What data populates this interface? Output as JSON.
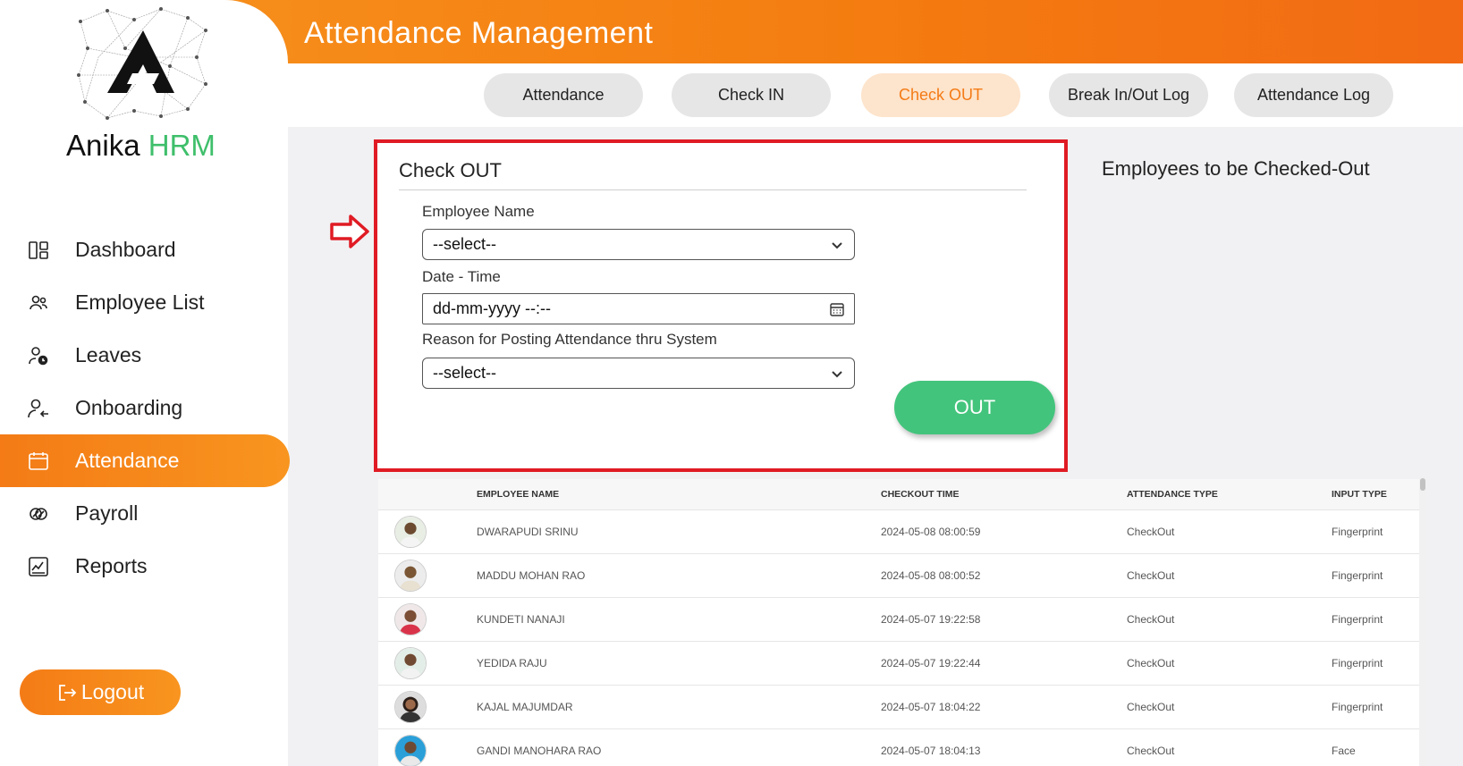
{
  "app": {
    "title": "Attendance Management"
  },
  "brand": {
    "name_part1": "Anika",
    "name_part2": "HRM"
  },
  "sidebar": {
    "items": [
      {
        "label": "Dashboard",
        "icon": "dashboard-icon",
        "active": false
      },
      {
        "label": "Employee List",
        "icon": "users-icon",
        "active": false
      },
      {
        "label": "Leaves",
        "icon": "user-clock-icon",
        "active": false
      },
      {
        "label": "Onboarding",
        "icon": "user-arrow-icon",
        "active": false
      },
      {
        "label": "Attendance",
        "icon": "calendar-icon",
        "active": true
      },
      {
        "label": "Payroll",
        "icon": "coins-icon",
        "active": false
      },
      {
        "label": "Reports",
        "icon": "report-icon",
        "active": false
      }
    ],
    "logout_label": "Logout"
  },
  "tabs": [
    {
      "label": "Attendance",
      "active": false
    },
    {
      "label": "Check IN",
      "active": false
    },
    {
      "label": "Check OUT",
      "active": true
    },
    {
      "label": "Break In/Out Log",
      "active": false
    },
    {
      "label": "Attendance Log",
      "active": false
    }
  ],
  "form": {
    "title": "Check OUT",
    "employee_label": "Employee Name",
    "employee_value": "--select--",
    "datetime_label": "Date - Time",
    "datetime_value": "dd-mm-yyyy --:--",
    "reason_label": "Reason for Posting Attendance thru System",
    "reason_value": "--select--",
    "out_button": "OUT"
  },
  "pending_title": "Employees to be Checked-Out",
  "table": {
    "headers": [
      "EMPLOYEE NAME",
      "CHECKOUT TIME",
      "ATTENDANCE TYPE",
      "INPUT TYPE"
    ],
    "rows": [
      {
        "name": "DWARAPUDI SRINU",
        "time": "2024-05-08 08:00:59",
        "type": "CheckOut",
        "input": "Fingerprint"
      },
      {
        "name": "MADDU MOHAN RAO",
        "time": "2024-05-08 08:00:52",
        "type": "CheckOut",
        "input": "Fingerprint"
      },
      {
        "name": "KUNDETI NANAJI",
        "time": "2024-05-07 19:22:58",
        "type": "CheckOut",
        "input": "Fingerprint"
      },
      {
        "name": "YEDIDA RAJU",
        "time": "2024-05-07 19:22:44",
        "type": "CheckOut",
        "input": "Fingerprint"
      },
      {
        "name": "KAJAL MAJUMDAR",
        "time": "2024-05-07 18:04:22",
        "type": "CheckOut",
        "input": "Fingerprint"
      },
      {
        "name": "GANDI MANOHARA RAO",
        "time": "2024-05-07 18:04:13",
        "type": "CheckOut",
        "input": "Face"
      }
    ]
  },
  "colors": {
    "accent": "#f47b16",
    "success": "#43c47c",
    "highlight": "#e01b24",
    "brand_green": "#3fbf6b"
  }
}
